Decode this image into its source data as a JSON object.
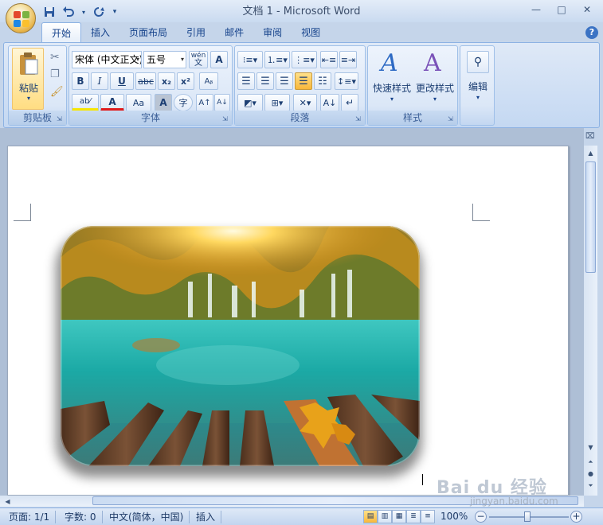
{
  "window": {
    "title": "文档 1 - Microsoft Word"
  },
  "qat": {
    "save_icon": "save-icon",
    "undo_icon": "undo-icon",
    "redo_icon": "redo-icon",
    "customize": "▾"
  },
  "window_controls": {
    "minimize": "—",
    "maximize": "□",
    "close": "✕"
  },
  "tabs": [
    {
      "label": "开始",
      "active": true
    },
    {
      "label": "插入"
    },
    {
      "label": "页面布局"
    },
    {
      "label": "引用"
    },
    {
      "label": "邮件"
    },
    {
      "label": "审阅"
    },
    {
      "label": "视图"
    }
  ],
  "help": "?",
  "ribbon": {
    "clipboard": {
      "label": "剪贴板",
      "paste": "粘贴"
    },
    "font": {
      "label": "字体",
      "font_name": "宋体 (中文正文)",
      "font_size": "五号",
      "phonetic_btn": "wén",
      "border_btn": "A",
      "bold": "B",
      "italic": "I",
      "underline": "U",
      "strike": "abc",
      "subscript": "x₂",
      "superscript": "x²",
      "clear": "Aᵦ",
      "highlight": "ab⁄",
      "font_color": "A",
      "case": "Aa",
      "shading": "A",
      "enclose": "字",
      "grow": "A↑",
      "shrink": "A↓"
    },
    "paragraph": {
      "label": "段落"
    },
    "styles": {
      "label": "样式",
      "quick": "快速样式",
      "change": "更改样式"
    },
    "editing": {
      "label": "编辑",
      "text": "编辑"
    }
  },
  "status": {
    "page": "页面: 1/1",
    "words": "字数: 0",
    "language": "中文(简体，中国)",
    "mode": "插入",
    "zoom": "100%",
    "zoom_minus": "−",
    "zoom_plus": "+"
  },
  "watermark": {
    "brand": "Bai du 经验",
    "url": "jingyan.baidu.com"
  },
  "colors": {
    "accent": "#15428b",
    "ribbon": "#dbe7f7",
    "page": "#ffffff"
  }
}
